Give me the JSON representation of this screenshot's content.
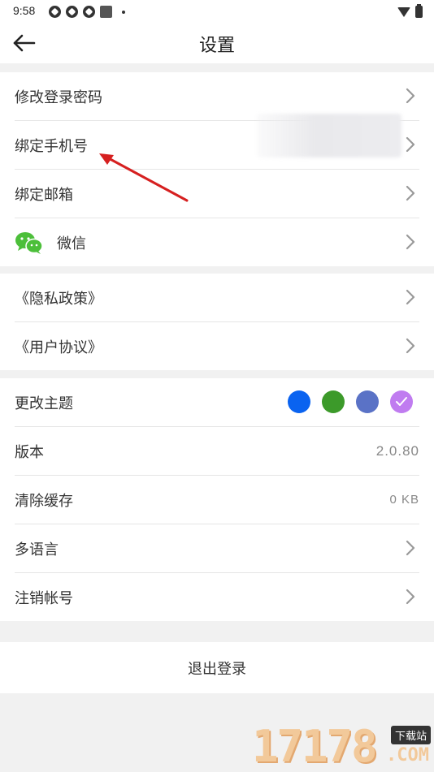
{
  "status": {
    "time": "9:58"
  },
  "header": {
    "title": "设置"
  },
  "account_group": [
    {
      "label": "修改登录密码"
    },
    {
      "label": "绑定手机号"
    },
    {
      "label": "绑定邮箱"
    },
    {
      "label": "微信"
    }
  ],
  "legal_group": [
    {
      "label": "《隐私政策》"
    },
    {
      "label": "《用户协议》"
    }
  ],
  "app_group": {
    "theme_label": "更改主题",
    "theme_colors": [
      "#0a63f0",
      "#3c9a2a",
      "#5a72c6",
      "#c07cf0"
    ],
    "theme_selected_index": 3,
    "version_label": "版本",
    "version_value": "2.0.80",
    "cache_label": "清除缓存",
    "cache_value": "0 KB",
    "language_label": "多语言",
    "cancel_account_label": "注销帐号"
  },
  "logout_label": "退出登录",
  "watermark": {
    "number": "17178",
    "tag": "下载站",
    "suffix": ".COM"
  },
  "colors": {
    "chevron": "#999999",
    "annotation_arrow": "#d62020",
    "wechat": "#4cbf3a"
  }
}
